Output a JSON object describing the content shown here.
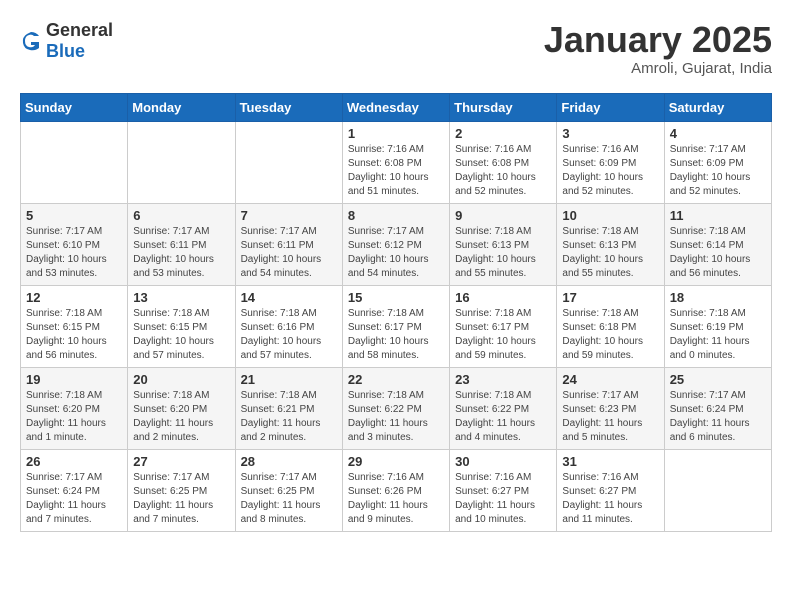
{
  "logo": {
    "general": "General",
    "blue": "Blue"
  },
  "header": {
    "month": "January 2025",
    "location": "Amroli, Gujarat, India"
  },
  "days_of_week": [
    "Sunday",
    "Monday",
    "Tuesday",
    "Wednesday",
    "Thursday",
    "Friday",
    "Saturday"
  ],
  "weeks": [
    [
      {
        "day": "",
        "info": ""
      },
      {
        "day": "",
        "info": ""
      },
      {
        "day": "",
        "info": ""
      },
      {
        "day": "1",
        "info": "Sunrise: 7:16 AM\nSunset: 6:08 PM\nDaylight: 10 hours\nand 51 minutes."
      },
      {
        "day": "2",
        "info": "Sunrise: 7:16 AM\nSunset: 6:08 PM\nDaylight: 10 hours\nand 52 minutes."
      },
      {
        "day": "3",
        "info": "Sunrise: 7:16 AM\nSunset: 6:09 PM\nDaylight: 10 hours\nand 52 minutes."
      },
      {
        "day": "4",
        "info": "Sunrise: 7:17 AM\nSunset: 6:09 PM\nDaylight: 10 hours\nand 52 minutes."
      }
    ],
    [
      {
        "day": "5",
        "info": "Sunrise: 7:17 AM\nSunset: 6:10 PM\nDaylight: 10 hours\nand 53 minutes."
      },
      {
        "day": "6",
        "info": "Sunrise: 7:17 AM\nSunset: 6:11 PM\nDaylight: 10 hours\nand 53 minutes."
      },
      {
        "day": "7",
        "info": "Sunrise: 7:17 AM\nSunset: 6:11 PM\nDaylight: 10 hours\nand 54 minutes."
      },
      {
        "day": "8",
        "info": "Sunrise: 7:17 AM\nSunset: 6:12 PM\nDaylight: 10 hours\nand 54 minutes."
      },
      {
        "day": "9",
        "info": "Sunrise: 7:18 AM\nSunset: 6:13 PM\nDaylight: 10 hours\nand 55 minutes."
      },
      {
        "day": "10",
        "info": "Sunrise: 7:18 AM\nSunset: 6:13 PM\nDaylight: 10 hours\nand 55 minutes."
      },
      {
        "day": "11",
        "info": "Sunrise: 7:18 AM\nSunset: 6:14 PM\nDaylight: 10 hours\nand 56 minutes."
      }
    ],
    [
      {
        "day": "12",
        "info": "Sunrise: 7:18 AM\nSunset: 6:15 PM\nDaylight: 10 hours\nand 56 minutes."
      },
      {
        "day": "13",
        "info": "Sunrise: 7:18 AM\nSunset: 6:15 PM\nDaylight: 10 hours\nand 57 minutes."
      },
      {
        "day": "14",
        "info": "Sunrise: 7:18 AM\nSunset: 6:16 PM\nDaylight: 10 hours\nand 57 minutes."
      },
      {
        "day": "15",
        "info": "Sunrise: 7:18 AM\nSunset: 6:17 PM\nDaylight: 10 hours\nand 58 minutes."
      },
      {
        "day": "16",
        "info": "Sunrise: 7:18 AM\nSunset: 6:17 PM\nDaylight: 10 hours\nand 59 minutes."
      },
      {
        "day": "17",
        "info": "Sunrise: 7:18 AM\nSunset: 6:18 PM\nDaylight: 10 hours\nand 59 minutes."
      },
      {
        "day": "18",
        "info": "Sunrise: 7:18 AM\nSunset: 6:19 PM\nDaylight: 11 hours\nand 0 minutes."
      }
    ],
    [
      {
        "day": "19",
        "info": "Sunrise: 7:18 AM\nSunset: 6:20 PM\nDaylight: 11 hours\nand 1 minute."
      },
      {
        "day": "20",
        "info": "Sunrise: 7:18 AM\nSunset: 6:20 PM\nDaylight: 11 hours\nand 2 minutes."
      },
      {
        "day": "21",
        "info": "Sunrise: 7:18 AM\nSunset: 6:21 PM\nDaylight: 11 hours\nand 2 minutes."
      },
      {
        "day": "22",
        "info": "Sunrise: 7:18 AM\nSunset: 6:22 PM\nDaylight: 11 hours\nand 3 minutes."
      },
      {
        "day": "23",
        "info": "Sunrise: 7:18 AM\nSunset: 6:22 PM\nDaylight: 11 hours\nand 4 minutes."
      },
      {
        "day": "24",
        "info": "Sunrise: 7:17 AM\nSunset: 6:23 PM\nDaylight: 11 hours\nand 5 minutes."
      },
      {
        "day": "25",
        "info": "Sunrise: 7:17 AM\nSunset: 6:24 PM\nDaylight: 11 hours\nand 6 minutes."
      }
    ],
    [
      {
        "day": "26",
        "info": "Sunrise: 7:17 AM\nSunset: 6:24 PM\nDaylight: 11 hours\nand 7 minutes."
      },
      {
        "day": "27",
        "info": "Sunrise: 7:17 AM\nSunset: 6:25 PM\nDaylight: 11 hours\nand 7 minutes."
      },
      {
        "day": "28",
        "info": "Sunrise: 7:17 AM\nSunset: 6:25 PM\nDaylight: 11 hours\nand 8 minutes."
      },
      {
        "day": "29",
        "info": "Sunrise: 7:16 AM\nSunset: 6:26 PM\nDaylight: 11 hours\nand 9 minutes."
      },
      {
        "day": "30",
        "info": "Sunrise: 7:16 AM\nSunset: 6:27 PM\nDaylight: 11 hours\nand 10 minutes."
      },
      {
        "day": "31",
        "info": "Sunrise: 7:16 AM\nSunset: 6:27 PM\nDaylight: 11 hours\nand 11 minutes."
      },
      {
        "day": "",
        "info": ""
      }
    ]
  ]
}
